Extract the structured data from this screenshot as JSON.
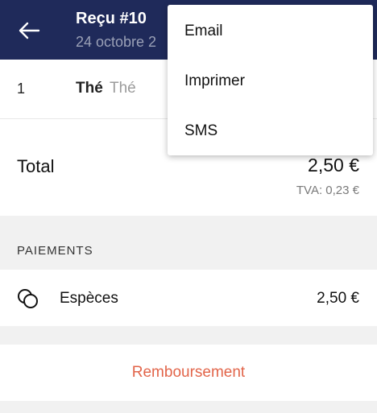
{
  "header": {
    "title": "Reçu #10",
    "subtitle": "24 octobre 2",
    "back_icon": "arrow-left-icon",
    "color": "#1f2a5a"
  },
  "items": [
    {
      "qty": "1",
      "name": "Thé",
      "desc": "Thé"
    }
  ],
  "totals": {
    "label": "Total",
    "amount": "2,50 €",
    "tva": "TVA: 0,23 €"
  },
  "payments": {
    "section_title": "PAIEMENTS",
    "items": [
      {
        "icon": "cash-coins-icon",
        "label": "Espèces",
        "amount": "2,50 €"
      }
    ]
  },
  "refund": {
    "label": "Remboursement",
    "color": "#e2654a"
  },
  "menu": {
    "items": [
      {
        "label": "Email"
      },
      {
        "label": "Imprimer"
      },
      {
        "label": "SMS"
      }
    ]
  }
}
